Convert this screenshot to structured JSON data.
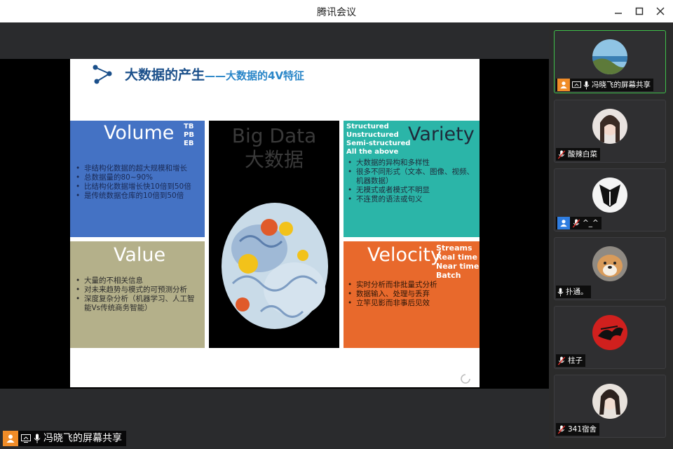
{
  "window": {
    "title": "腾讯会议",
    "controls": [
      "minimize-icon",
      "maximize-icon",
      "close-icon"
    ]
  },
  "slide": {
    "title": "大数据的产生",
    "subtitle": "——大数据的4V特征",
    "volume": {
      "heading": "Volume",
      "tags": [
        "TB",
        "PB",
        "EB"
      ],
      "bullets": [
        "非结构化数据的超大规模和增长",
        "总数据量的80~90%",
        "比结构化数据增长快10倍到50倍",
        "是传统数据仓库的10倍到50倍"
      ],
      "color": "#4472c4"
    },
    "bigdata": {
      "line1": "Big Data",
      "line2": "大数据"
    },
    "variety": {
      "heading": "Variety",
      "tags": [
        "Structured",
        "Unstructured",
        "Semi-structured",
        "All  the above"
      ],
      "bullets": [
        "大数据的异构和多样性",
        "很多不同形式（文本、图像、视频、机器数据）",
        "无模式或者模式不明显",
        "不连贯的语法或句义"
      ],
      "color": "#2bb5a8"
    },
    "value": {
      "heading": "Value",
      "bullets": [
        "大量的不相关信息",
        "对未来趋势与模式的可预测分析",
        "深度复杂分析（机器学习、人工智能Vs传统商务智能）"
      ],
      "color": "#b4b08a"
    },
    "velocity": {
      "heading": "Velocity",
      "tags": [
        "Streams",
        "Real time",
        "Near time",
        "Batch"
      ],
      "bullets": [
        "实时分析而非批量式分析",
        "数据输入、处理与丢弃",
        "立竿见影而非事后见效"
      ],
      "color": "#e8692c"
    }
  },
  "participants": [
    {
      "name": "冯晓飞的屏幕共享",
      "icons": [
        "person-icon",
        "screen-share-icon",
        "mic-icon"
      ],
      "avatar": "landscape",
      "active": true
    },
    {
      "name": "酸辣白菜",
      "icons": [
        "mic-muted-icon"
      ],
      "avatar": "girl"
    },
    {
      "name": "^_^",
      "icons": [
        "person-icon",
        "mic-muted-icon"
      ],
      "avatar": "logo"
    },
    {
      "name": "扑通。",
      "icons": [
        "mic-icon"
      ],
      "avatar": "dog"
    },
    {
      "name": "柱子",
      "icons": [
        "mic-muted-icon"
      ],
      "avatar": "red"
    },
    {
      "name": "341宿舍",
      "icons": [
        "mic-muted-icon"
      ],
      "avatar": "woman"
    }
  ],
  "presenter_label": "冯晓飞的屏幕共享"
}
